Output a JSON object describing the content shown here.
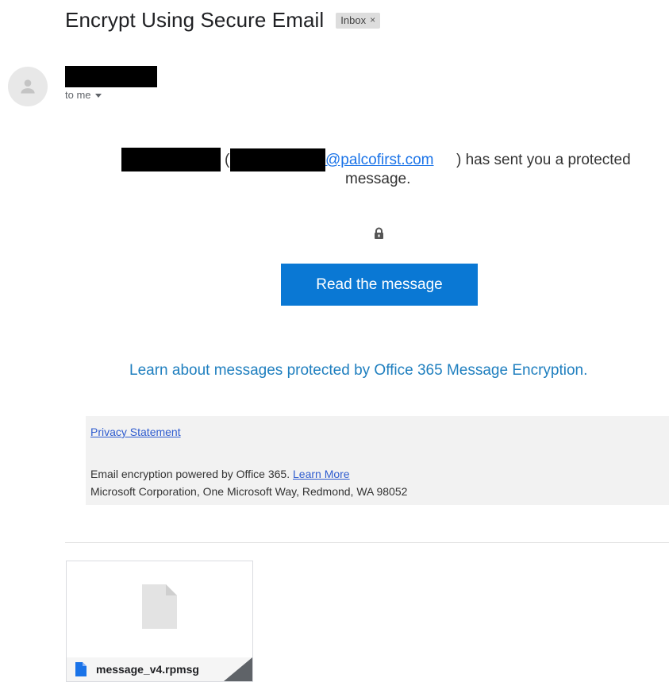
{
  "email": {
    "subject": "Encrypt Using Secure Email",
    "label_chip": "Inbox",
    "label_chip_close": "×",
    "to": "to me"
  },
  "body": {
    "paren_open": "(",
    "email_domain": "@palcofirst.com",
    "sent_text": ") has sent you a protected",
    "sent_text_2": "message.",
    "read_button": "Read the message",
    "learn_link": "Learn about messages protected by Office 365 Message Encryption."
  },
  "footer": {
    "privacy": "Privacy Statement",
    "powered": "Email encryption powered by Office 365.",
    "learn_more": "Learn More",
    "address": "Microsoft Corporation, One Microsoft Way, Redmond, WA 98052"
  },
  "attachment": {
    "filename": "message_v4.rpmsg"
  },
  "colors": {
    "button": "#0a78d4",
    "link": "#1a73e8",
    "footer_bg": "#f2f2f2"
  },
  "icons": [
    "person-icon",
    "chevron-down-icon",
    "lock-icon",
    "document-icon",
    "file-icon"
  ]
}
